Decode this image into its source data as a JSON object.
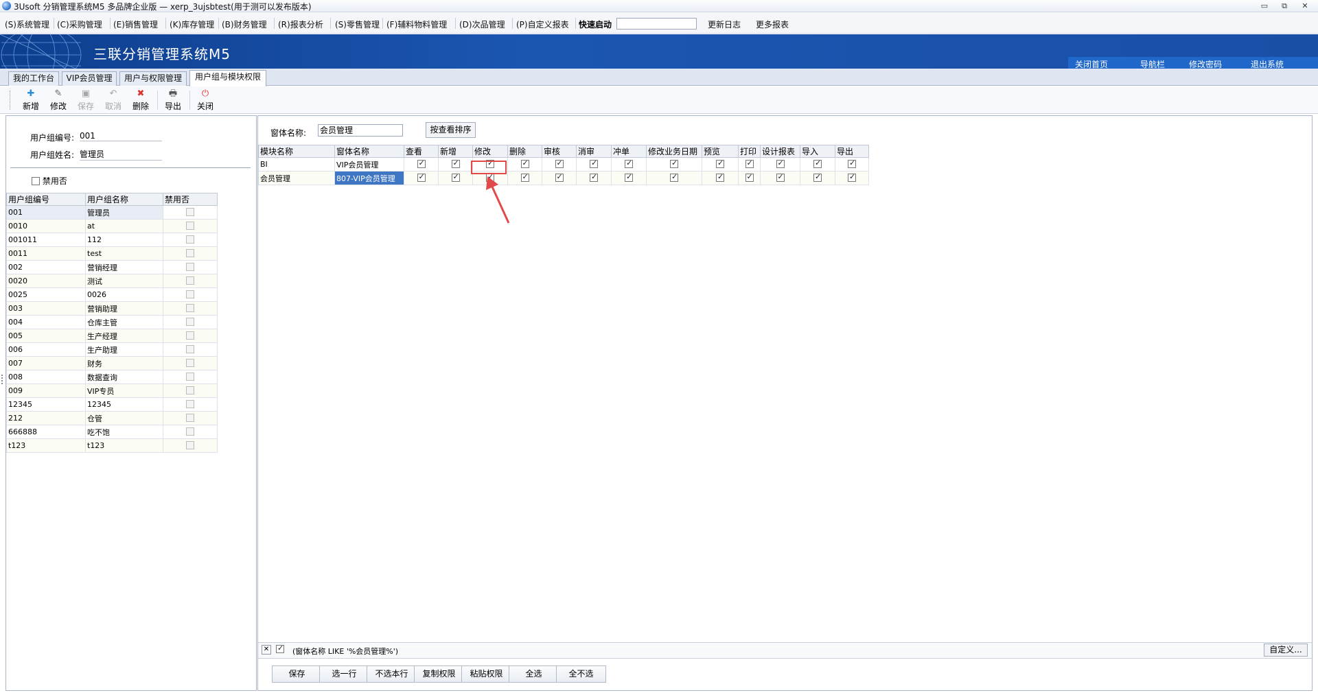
{
  "window": {
    "title": "3Usoft 分销管理系统M5 多品牌企业版 — xerp_3ujsbtest(用于测可以发布版本)",
    "minimize": "▭",
    "restore": "⧉",
    "close": "✕"
  },
  "menu": {
    "items": [
      "(S)系统管理",
      "(C)采购管理",
      "(E)销售管理",
      "(K)库存管理",
      "(B)财务管理",
      "(R)报表分析",
      "(S)零售管理",
      "(F)辅料物料管理",
      "(D)次品管理",
      "(P)自定义报表"
    ],
    "quick_start": "快速启动",
    "quick_start_value": "",
    "changelog": "更新日志",
    "more_reports": "更多报表"
  },
  "banner": {
    "brand": "三联分销管理系统M5",
    "links": [
      "关闭首页",
      "导航栏",
      "修改密码",
      "退出系统"
    ]
  },
  "tabs": [
    "我的工作台",
    "VIP会员管理",
    "用户与权限管理",
    "用户组与模块权限"
  ],
  "active_tab": 3,
  "toolbar": {
    "add": "新增",
    "edit": "修改",
    "save": "保存",
    "cancel": "取消",
    "delete": "删除",
    "export": "导出",
    "close": "关闭"
  },
  "left": {
    "group_code_label": "用户组编号:",
    "group_code": "001",
    "group_name_label": "用户组姓名:",
    "group_name": "管理员",
    "disabled_label": "禁用否",
    "columns": [
      "用户组编号",
      "用户组名称",
      "禁用否"
    ],
    "rows": [
      [
        "001",
        "管理员"
      ],
      [
        "0010",
        "at"
      ],
      [
        "001011",
        "112"
      ],
      [
        "0011",
        "test"
      ],
      [
        "002",
        "营销经理"
      ],
      [
        "0020",
        "测试"
      ],
      [
        "0025",
        "0026"
      ],
      [
        "003",
        "营销助理"
      ],
      [
        "004",
        "仓库主管"
      ],
      [
        "005",
        "生产经理"
      ],
      [
        "006",
        "生产助理"
      ],
      [
        "007",
        "财务"
      ],
      [
        "008",
        "数据查询"
      ],
      [
        "009",
        "VIP专员"
      ],
      [
        "12345",
        "12345"
      ],
      [
        "212",
        "仓管"
      ],
      [
        "666888",
        "吃不饱"
      ],
      [
        "t123",
        "t123"
      ]
    ]
  },
  "right": {
    "form_name_label": "窗体名称:",
    "form_name_value": "会员管理",
    "sort_button": "按查看排序",
    "columns": [
      "模块名称",
      "窗体名称",
      "查看",
      "新增",
      "修改",
      "删除",
      "审核",
      "消审",
      "冲单",
      "修改业务日期",
      "预览",
      "打印",
      "设计报表",
      "导入",
      "导出"
    ],
    "rows": [
      {
        "module": "BI",
        "form": "VIP会员管理"
      },
      {
        "module": "会员管理",
        "form": "807-VIP会员管理"
      }
    ],
    "filter_text": "(窗体名称 LIKE '%会员管理%')",
    "custom_button": "自定义...",
    "actions": [
      "保存",
      "选一行",
      "不选本行",
      "复制权限",
      "粘贴权限",
      "全选",
      "全不选"
    ]
  },
  "colors": {
    "banner": "#1b56b1",
    "selection": "#3f76c4",
    "highlight": "#e24a4a"
  }
}
